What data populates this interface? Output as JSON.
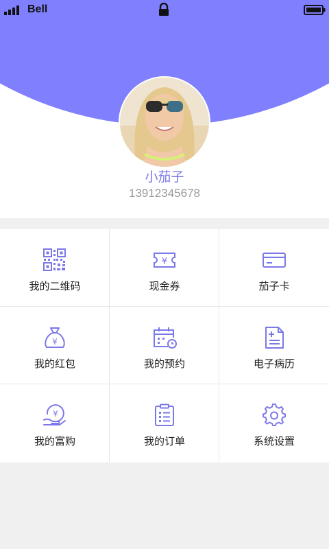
{
  "status_bar": {
    "carrier": "Bell",
    "signal_icon": "signal-bars-icon",
    "lock_icon": "lock-icon",
    "battery_icon": "battery-icon"
  },
  "profile": {
    "name": "小茄子",
    "phone": "13912345678",
    "avatar": "user-avatar-photo"
  },
  "colors": {
    "accent": "#8080ff",
    "label_accent": "#7b78e8",
    "page_bg": "#f0f0f0",
    "divider": "#e6e6e6"
  },
  "menu": [
    {
      "label": "我的二维码",
      "icon": "qr-code-icon"
    },
    {
      "label": "现金券",
      "icon": "cash-coupon-icon"
    },
    {
      "label": "茄子卡",
      "icon": "card-icon"
    },
    {
      "label": "我的红包",
      "icon": "money-bag-icon"
    },
    {
      "label": "我的预约",
      "icon": "calendar-clock-icon"
    },
    {
      "label": "电子病历",
      "icon": "medical-record-icon"
    },
    {
      "label": "我的富购",
      "icon": "yen-hand-icon"
    },
    {
      "label": "我的订单",
      "icon": "clipboard-list-icon"
    },
    {
      "label": "系统设置",
      "icon": "gear-icon"
    }
  ]
}
